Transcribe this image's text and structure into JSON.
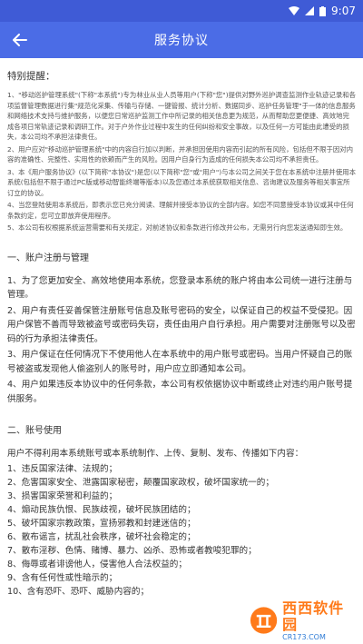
{
  "status": {
    "time": "9:07"
  },
  "header": {
    "title": "服务协议"
  },
  "intro": {
    "title": "特别提醒：",
    "paragraphs": [
      "1、\"移动巡护管理系统\"(下称\"本系统\")专为林业从业人员等用户(下称\"您\")提供对野外巡护调查监测作业轨迹记录和各项监督管理数据进行集\"规范化采集、传输与存储、一键管报、统计分析、数据同步、巡护任务管理\"于一体的信息服务和网络技术支持与维护服务，以便您日常巡护监测工作中所记录的相关信息更为规范，从而帮助您更便捷、高效地完成各项日常轨迹记录和调研工作。对于户外作业过程中发生的任何纠纷和安全事故，以及任何一方可能由此遭受的损失，本公司均不承担法律责任。",
      "2、用户应对\"移动巡护管理系统\"中的内容自行加以判断，并承担因使用内容而引起的所有风险，包括但不限于因对内容的准确性、完整性、实用性的依赖而产生的风险。因用户自身行为造成的任何损失本公司均不承担责任。",
      "3、本《用户服务协议》(以下简称\"本协议\")是您(以下简称\"您\"或\"用户\")与本公司之间关于您在本系统中注册并使用本系统(包括但不限于通过PC版或移动智能终端等版本)以及您通过本系统获取相关信息、咨询建议及服务等相关事宜所订立的协议。",
      "4、当您登陆使用本系统后，即表示您已充分阅读、理解并接受本协议的全部内容。如您不同意接受本协议或其中任何条款约定，您可立即放弃使用程序。",
      "5、本公司有权根据系统运营需要和有关规定，对前述协议和条款进行修改并公布，无需另行向您发送通知即生效。"
    ]
  },
  "section1": {
    "title": "一、账户注册与管理",
    "paragraphs": [
      "1、为了您更加安全、高效地使用本系统，您登录本系统的账户将由本公司统一进行注册与管理。",
      "2、用户有责任妥善保管注册账号信息及账号密码的安全，以保证自己的权益不受侵犯。因用户保管不善而导致被盗号或密码失窃，责任由用户自行承担。用户需要对注册账号以及密码的行为承担法律责任。",
      "3、用户保证在任何情况下不使用他人在本系统中的用户账号或密码。当用户怀疑自己的账号被盗或发现他人偷盗别人的账号时，用户应立即通知本公司。",
      "4、用户如果违反本协议中的任何条款，本公司有权依据协议中断或终止对违约用户账号提供服务。"
    ]
  },
  "section2": {
    "title": "二、账号使用",
    "intro": "用户不得利用本系统账号或本系统制作、上传、复制、发布、传播如下内容：",
    "items": [
      "1、违反国家法律、法规的；",
      "2、危害国家安全、泄露国家秘密，颠覆国家政权，破坏国家统一的；",
      "3、损害国家荣誉和利益的；",
      "4、煽动民族仇恨、民族歧视，破坏民族团结的；",
      "5、破坏国家宗教政策，宣扬邪教和封建迷信的；",
      "6、散布谣言，扰乱社会秩序，破坏社会稳定的；",
      "7、散布淫秽、色情、赌博、暴力、凶杀、恐怖或者教唆犯罪的；",
      "8、侮辱或者诽谤他人，侵害他人合法权益的；",
      "9、含有任何性或性暗示的；",
      "10、含有恐吓、恐吓、威胁内容的；"
    ]
  },
  "watermark": {
    "text": "西西软件园",
    "url": "CR173.COM"
  },
  "colors": {
    "app_bar": "#4b6ce6",
    "status_bar": "#3f5bd6"
  }
}
